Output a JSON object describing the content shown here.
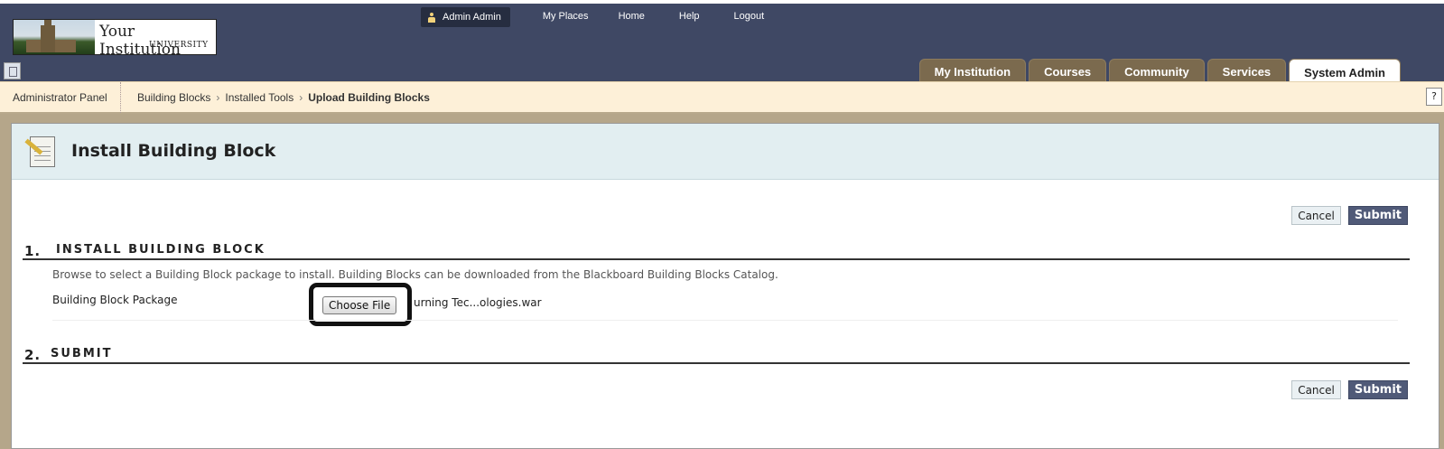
{
  "header": {
    "logo": {
      "line1": "Your Institution",
      "line2": "UNIVERSITY"
    },
    "user_name": "Admin Admin",
    "nav": [
      "My Places",
      "Home",
      "Help",
      "Logout"
    ],
    "tabs": [
      {
        "label": "My Institution",
        "active": false
      },
      {
        "label": "Courses",
        "active": false
      },
      {
        "label": "Community",
        "active": false
      },
      {
        "label": "Services",
        "active": false
      },
      {
        "label": "System Admin",
        "active": true
      }
    ]
  },
  "breadcrumb": {
    "panel": "Administrator Panel",
    "items": [
      "Building Blocks",
      "Installed Tools",
      "Upload Building Blocks"
    ],
    "separator": "›",
    "help": "?"
  },
  "page": {
    "title": "Install Building Block",
    "cancel_label": "Cancel",
    "submit_label": "Submit",
    "steps": [
      {
        "num": "1.",
        "title": "INSTALL BUILDING BLOCK"
      },
      {
        "num": "2.",
        "title": "SUBMIT"
      }
    ],
    "instructions": "Browse to select a Building Block package to install. Building Blocks can be downloaded from the Blackboard Building Blocks Catalog.",
    "field_label": "Building Block Package",
    "choose_file_label": "Choose File",
    "file_name": "urning Tec...ologies.war"
  },
  "colors": {
    "header_bg": "#3f4864",
    "tab_bg": "#7b6a4e",
    "crumb_bg": "#fdf0d8",
    "page_header_bg": "#e2eef1",
    "submit_bg": "#505a78"
  }
}
